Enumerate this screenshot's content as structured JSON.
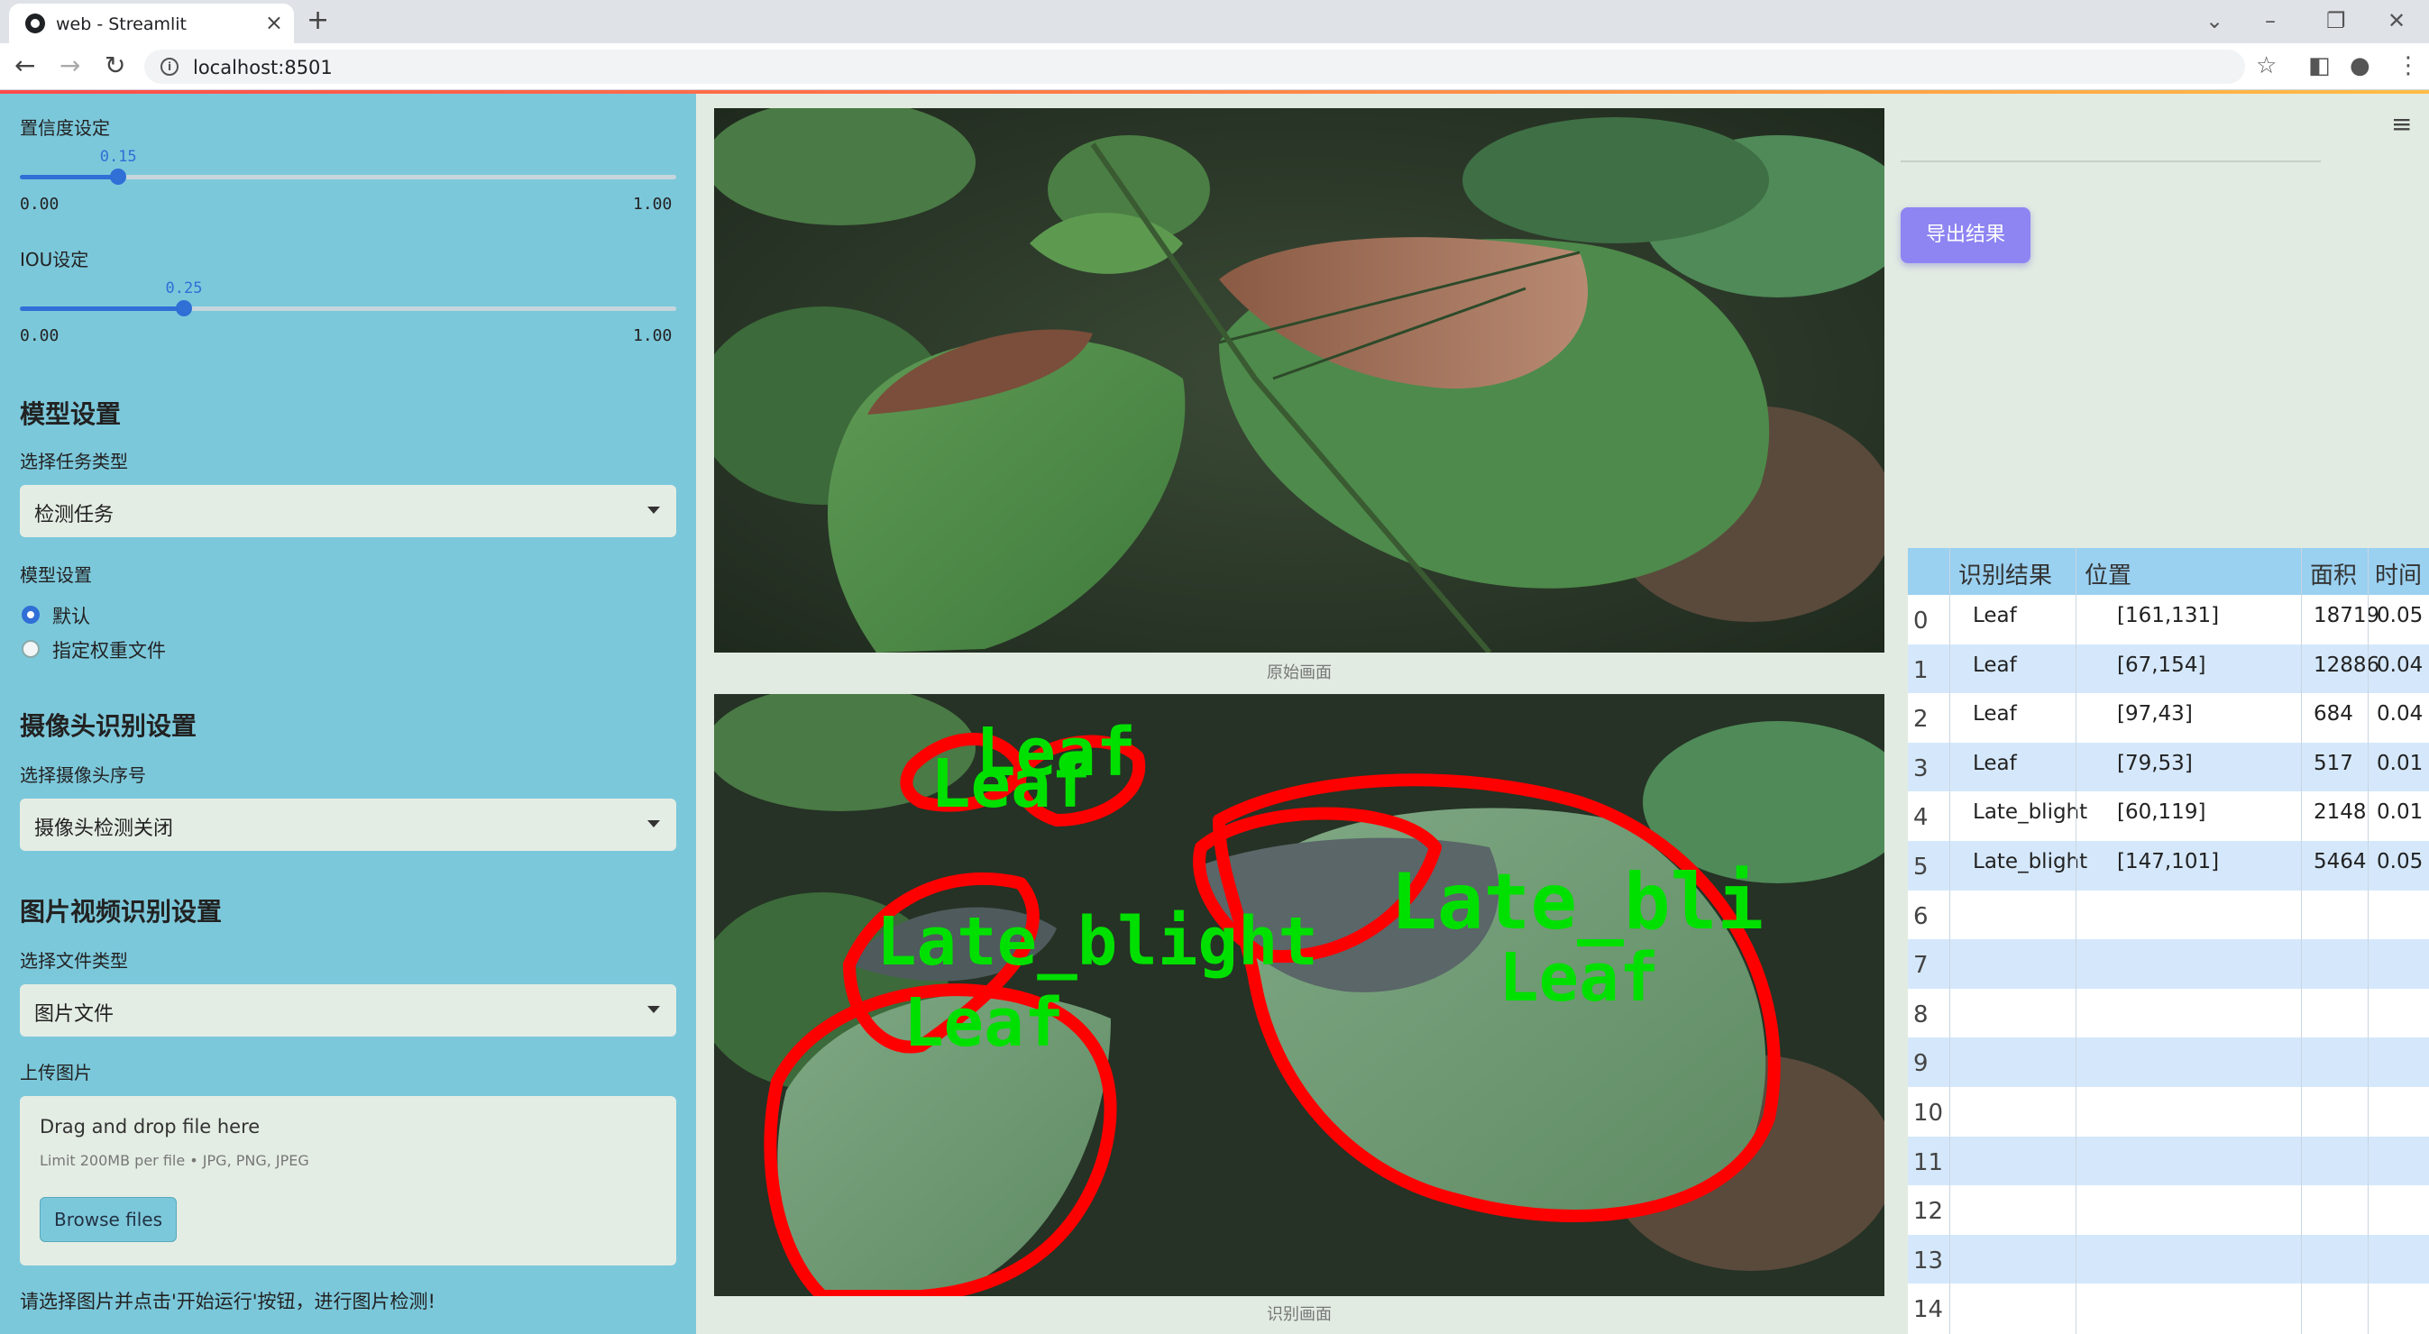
{
  "browser": {
    "tab_title": "web - Streamlit",
    "url": "localhost:8501"
  },
  "sidebar": {
    "confidence": {
      "label": "置信度设定",
      "value": "0.15",
      "value_fraction": 0.15,
      "min": "0.00",
      "max": "1.00"
    },
    "iou": {
      "label": "IOU设定",
      "value": "0.25",
      "value_fraction": 0.25,
      "min": "0.00",
      "max": "1.00"
    },
    "model_section": "模型设置",
    "task_label": "选择任务类型",
    "task_value": "检测任务",
    "model_label": "模型设置",
    "model_options": [
      "默认",
      "指定权重文件"
    ],
    "model_selected": 0,
    "camera_section": "摄像头识别设置",
    "camera_label": "选择摄像头序号",
    "camera_value": "摄像头检测关闭",
    "media_section": "图片视频识别设置",
    "file_type_label": "选择文件类型",
    "file_type_value": "图片文件",
    "upload_label": "上传图片",
    "upload_title": "Drag and drop file here",
    "upload_limit": "Limit 200MB per file • JPG, PNG, JPEG",
    "browse_label": "Browse files",
    "hint": "请选择图片并点击'开始运行'按钮，进行图片检测!"
  },
  "main": {
    "original_caption": "原始画面",
    "result_caption": "识别画面",
    "export_label": "导出结果",
    "detection_labels": [
      "Leaf",
      "Leaf",
      "Late_bli",
      "Late_blight",
      "Leaf",
      "Leaf"
    ]
  },
  "table": {
    "headers": [
      "识别结果",
      "位置",
      "面积",
      "时间"
    ],
    "rows": [
      {
        "idx": "0",
        "result": "Leaf",
        "pos": "[161,131]",
        "area": "18719",
        "time": "0.05"
      },
      {
        "idx": "1",
        "result": "Leaf",
        "pos": "[67,154]",
        "area": "12886",
        "time": "0.04"
      },
      {
        "idx": "2",
        "result": "Leaf",
        "pos": "[97,43]",
        "area": "684",
        "time": "0.04"
      },
      {
        "idx": "3",
        "result": "Leaf",
        "pos": "[79,53]",
        "area": "517",
        "time": "0.01"
      },
      {
        "idx": "4",
        "result": "Late_blight",
        "pos": "[60,119]",
        "area": "2148",
        "time": "0.01"
      },
      {
        "idx": "5",
        "result": "Late_blight",
        "pos": "[147,101]",
        "area": "5464",
        "time": "0.05"
      },
      {
        "idx": "6"
      },
      {
        "idx": "7"
      },
      {
        "idx": "8"
      },
      {
        "idx": "9"
      },
      {
        "idx": "10"
      },
      {
        "idx": "11"
      },
      {
        "idx": "12"
      },
      {
        "idx": "13"
      },
      {
        "idx": "14"
      }
    ]
  },
  "colors": {
    "sidebar_bg": "#7cc8db",
    "accent": "#2f6fd6",
    "export_button": "#8e85f2",
    "table_header": "#9ad0f0",
    "row_alt": "#d5e8fb",
    "detection_outline": "#ff0000",
    "detection_text": "#00e000"
  }
}
